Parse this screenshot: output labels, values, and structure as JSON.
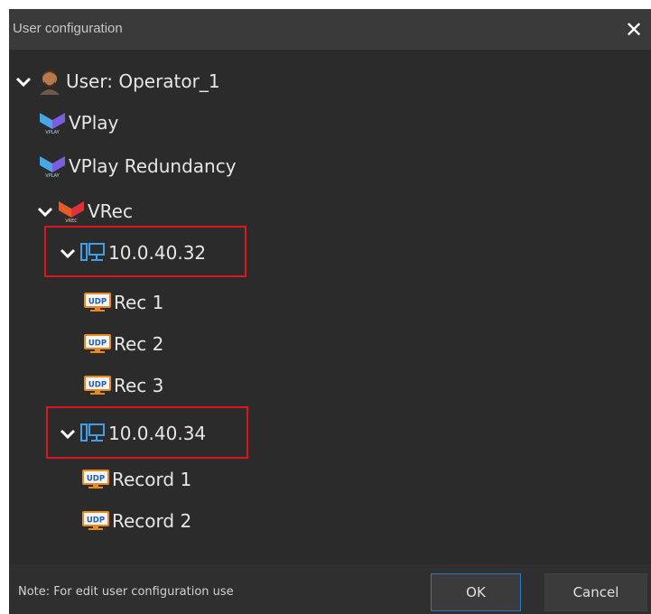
{
  "dialog": {
    "title": "User configuration",
    "close_icon": "close-icon"
  },
  "tree": {
    "user": {
      "label": "User: Operator_1",
      "icon": "user-avatar-icon"
    },
    "vplay": {
      "label": "VPlay",
      "icon": "vplay-logo-icon"
    },
    "vplay_redundancy": {
      "label": "VPlay Redundancy",
      "icon": "vplay-logo-icon"
    },
    "vrec": {
      "label": "VRec",
      "icon": "vrec-logo-icon"
    },
    "hosts": [
      {
        "label": "10.0.40.32",
        "icon": "computer-icon",
        "children": [
          {
            "label": "Rec 1",
            "icon": "udp-icon"
          },
          {
            "label": "Rec 2",
            "icon": "udp-icon"
          },
          {
            "label": "Rec 3",
            "icon": "udp-icon"
          }
        ]
      },
      {
        "label": "10.0.40.34",
        "icon": "computer-icon",
        "children": [
          {
            "label": "Record 1",
            "icon": "udp-icon"
          },
          {
            "label": "Record 2",
            "icon": "udp-icon"
          }
        ]
      }
    ],
    "udp_badge_text": "UDP"
  },
  "footer": {
    "note": "Note: For edit user configuration use",
    "ok_label": "OK",
    "cancel_label": "Cancel"
  },
  "colors": {
    "highlight": "#e0141e",
    "ok_border": "#2a78c8",
    "dialog_bg": "#2b2b2b"
  }
}
